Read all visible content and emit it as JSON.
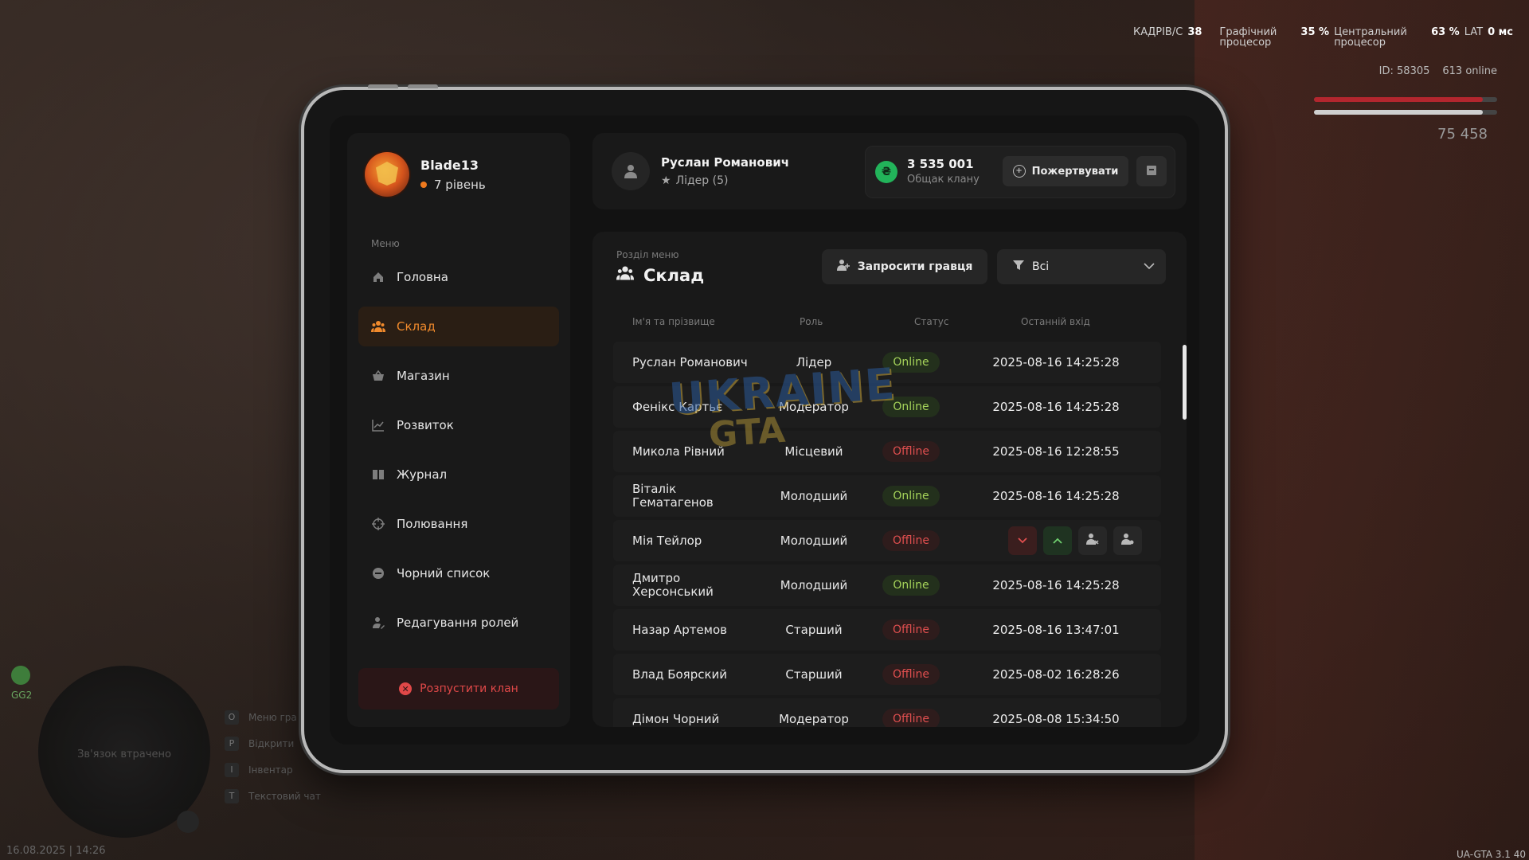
{
  "hud": {
    "fps_label": "КАДРІВ/С",
    "fps_value": "38",
    "gpu_label": "Графічний процесор",
    "cpu_percent": "35 %",
    "cpu_label": "Центральний процесор",
    "cpu_short_label": "процесор",
    "lat_percent": "63 %",
    "lat_label": "LAT",
    "lat_ms": "0 мс",
    "player_id": "ID: 58305",
    "online": "613 online",
    "health": "100",
    "armor": "100",
    "money": "75 458",
    "minimap_text": "Зв'язок втрачено",
    "health_value": "GG2",
    "keys": [
      {
        "key": "O",
        "label": "Меню гра"
      },
      {
        "key": "P",
        "label": "Відкрити"
      },
      {
        "key": "I",
        "label": "Інвентар"
      },
      {
        "key": "T",
        "label": "Текстовий чат"
      }
    ],
    "datetime": "16.08.2025 | 14:26",
    "version": "UA-GTA 3.1",
    "version_extra": "40"
  },
  "sidebar": {
    "clan_name": "Blade13",
    "clan_level": "7 рівень",
    "menu_caption": "Меню",
    "items": [
      {
        "label": "Головна",
        "icon": "home-icon"
      },
      {
        "label": "Склад",
        "icon": "people-icon"
      },
      {
        "label": "Магазин",
        "icon": "basket-icon"
      },
      {
        "label": "Розвиток",
        "icon": "chart-icon"
      },
      {
        "label": "Журнал",
        "icon": "book-icon"
      },
      {
        "label": "Полювання",
        "icon": "crosshair-icon"
      },
      {
        "label": "Чорний список",
        "icon": "block-icon"
      },
      {
        "label": "Редагування ролей",
        "icon": "user-edit-icon"
      }
    ],
    "active_item": "Склад",
    "disband_label": "Розпустити клан"
  },
  "topbar": {
    "user_name": "Руслан Романович",
    "user_role": "Лідер (5)",
    "treasury_amount": "3 535 001",
    "treasury_label": "Общак клану",
    "donate_label": "Пожертвувати"
  },
  "section": {
    "caption": "Розділ меню",
    "title": "Склад",
    "invite_label": "Запросити гравця",
    "filter_value": "Всі"
  },
  "table": {
    "headers": {
      "name": "Ім'я та прізвище",
      "role": "Роль",
      "status": "Статус",
      "last": "Останній вхід"
    },
    "rows": [
      {
        "name": "Руслан Романович",
        "role": "Лідер",
        "status": "Online",
        "last": "2025-08-16 14:25:28"
      },
      {
        "name": "Фенікс Картьє",
        "role": "Модератор",
        "status": "Online",
        "last": "2025-08-16 14:25:28"
      },
      {
        "name": "Микола Рівний",
        "role": "Місцевий",
        "status": "Offline",
        "last": "2025-08-16 12:28:55"
      },
      {
        "name": "Віталік Гематагенов",
        "role": "Молодший",
        "status": "Online",
        "last": "2025-08-16 14:25:28"
      },
      {
        "name": "Мія Тейлор",
        "role": "Молодший",
        "status": "Offline",
        "last": ""
      },
      {
        "name": "Дмитро Херсонський",
        "role": "Молодший",
        "status": "Online",
        "last": "2025-08-16 14:25:28"
      },
      {
        "name": "Назар Артемов",
        "role": "Старший",
        "status": "Offline",
        "last": "2025-08-16 13:47:01"
      },
      {
        "name": "Влад Боярский",
        "role": "Старший",
        "status": "Offline",
        "last": "2025-08-02 16:28:26"
      },
      {
        "name": "Дімон Чорний",
        "role": "Модератор",
        "status": "Offline",
        "last": "2025-08-08 15:34:50"
      }
    ]
  },
  "watermark": {
    "line1": "UKRAINE",
    "line2": "GTA"
  },
  "colors": {
    "accent": "#f08a2c",
    "online": "#a5d35a",
    "offline": "#e04f4f",
    "coin": "#22b35a"
  }
}
